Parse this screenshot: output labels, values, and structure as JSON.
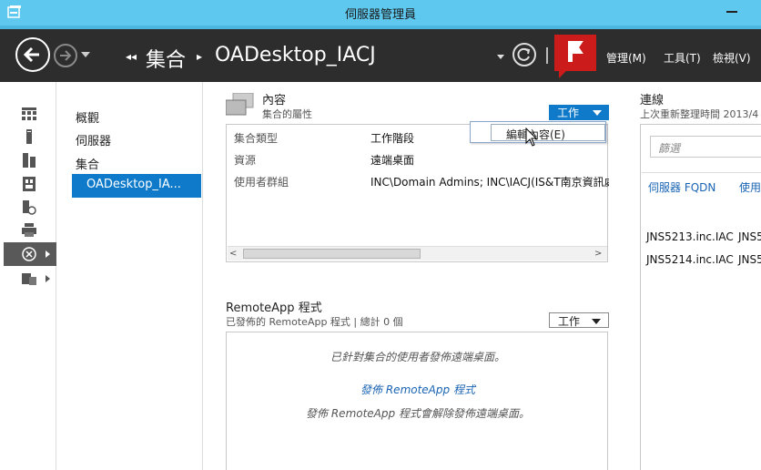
{
  "window": {
    "title": "伺服器管理員"
  },
  "navbar": {
    "breadcrumb": [
      "集合",
      "OADesktop_IACJ"
    ],
    "menus": [
      "管理(M)",
      "工具(T)",
      "檢視(V)"
    ],
    "colors": {
      "bar": "#2d2d2d",
      "accent": "#4bb6e0",
      "flag": "#cc1b1b"
    }
  },
  "leftbar": {
    "icons": [
      "dashboard-icon",
      "local-server-icon",
      "all-servers-icon",
      "file-storage-icon",
      "iis-icon",
      "print-services-icon",
      "remote-desktop-icon",
      "file-services-icon"
    ]
  },
  "secnav": {
    "items": [
      "概觀",
      "伺服器",
      "集合"
    ],
    "selected": "OADesktop_IA..."
  },
  "properties": {
    "title": "內容",
    "subtitle": "集合的屬性",
    "task_label": "工作",
    "rows": [
      {
        "label": "集合類型",
        "value": "工作階段"
      },
      {
        "label": "資源",
        "value": "遠端桌面"
      },
      {
        "label": "使用者群組",
        "value": "INC\\Domain Admins; INC\\IACJ(IS&T南京資訊處"
      }
    ],
    "popup_item": "編輯內容(E)"
  },
  "remoteapp": {
    "title": "RemoteApp 程式",
    "subtitle": "已發佈的 RemoteApp 程式 | 總計 0 個",
    "task_label": "工作",
    "message1": "已針對集合的使用者發佈遠端桌面。",
    "link": "發佈 RemoteApp 程式",
    "message2": "發佈 RemoteApp 程式會解除發佈遠端桌面。"
  },
  "connections": {
    "title": "連線",
    "subtitle": "上次重新整理時間 2013/4",
    "filter_placeholder": "篩選",
    "columns": [
      "伺服器 FQDN",
      "使用"
    ],
    "rows": [
      [
        "JNS5213.inc.IAC",
        "JNS5"
      ],
      [
        "JNS5214.inc.IAC",
        "JNS5"
      ]
    ]
  }
}
